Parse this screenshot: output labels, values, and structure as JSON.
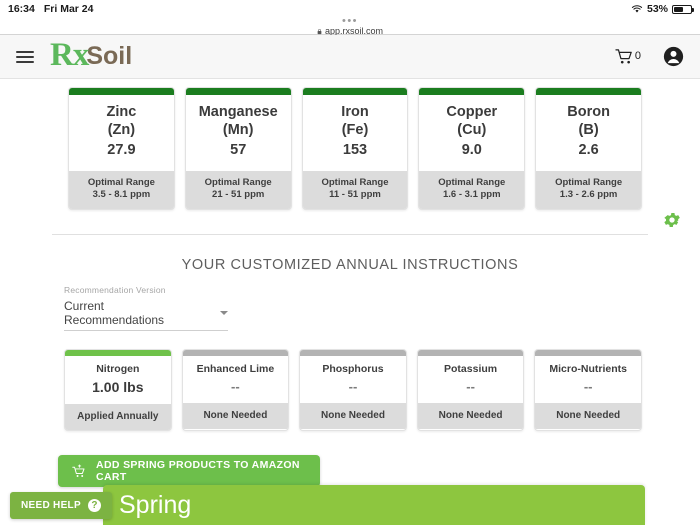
{
  "status_bar": {
    "time": "16:34",
    "date": "Fri Mar 24",
    "battery_percent": "53%",
    "wifi_icon": "wifi-icon",
    "battery_icon": "battery-icon"
  },
  "browser": {
    "dots": "•••",
    "url": "app.rxsoil.com",
    "lock_icon": "lock-icon"
  },
  "header": {
    "menu_icon": "hamburger-menu-icon",
    "logo_rx": "Rx",
    "logo_soil": "Soil",
    "cart_icon": "shopping-cart-icon",
    "cart_count": "0",
    "account_icon": "account-avatar-icon"
  },
  "settings": {
    "gear_icon": "gear-icon",
    "color": "#6cbf4b"
  },
  "nutrients": {
    "footer_label": "Optimal Range",
    "bar_color": "#1b7d1f",
    "cards": [
      {
        "name": "Zinc",
        "symbol": "(Zn)",
        "value": "27.9",
        "range": "3.5 - 8.1 ppm"
      },
      {
        "name": "Manganese",
        "symbol": "(Mn)",
        "value": "57",
        "range": "21 - 51 ppm"
      },
      {
        "name": "Iron",
        "symbol": "(Fe)",
        "value": "153",
        "range": "11 - 51 ppm"
      },
      {
        "name": "Copper",
        "symbol": "(Cu)",
        "value": "9.0",
        "range": "1.6 - 3.1 ppm"
      },
      {
        "name": "Boron",
        "symbol": "(B)",
        "value": "2.6",
        "range": "1.3 - 2.6 ppm"
      }
    ]
  },
  "instructions": {
    "title": "YOUR CUSTOMIZED ANNUAL INSTRUCTIONS",
    "select_label": "Recommendation Version",
    "select_value": "Current Recommendations",
    "select_options": [
      "Current Recommendations"
    ],
    "caret_icon": "chevron-down-icon"
  },
  "recommendations": {
    "active_bar_color": "#6fc24a",
    "inactive_bar_color": "#b3b3b3",
    "cards": [
      {
        "name": "Nitrogen",
        "value": "1.00 lbs",
        "status": "Applied Annually",
        "active": true
      },
      {
        "name": "Enhanced Lime",
        "value": "--",
        "status": "None Needed",
        "active": false
      },
      {
        "name": "Phosphorus",
        "value": "--",
        "status": "None Needed",
        "active": false
      },
      {
        "name": "Potassium",
        "value": "--",
        "status": "None Needed",
        "active": false
      },
      {
        "name": "Micro-Nutrients",
        "value": "--",
        "status": "None Needed",
        "active": false
      }
    ]
  },
  "amazon_button": {
    "label": "ADD SPRING PRODUCTS TO AMAZON CART",
    "icon": "add-to-cart-icon",
    "color": "#6dbf4b"
  },
  "season_banner": {
    "label": "Spring",
    "color": "#8dc63f"
  },
  "need_help": {
    "label": "NEED HELP",
    "icon": "question-mark-icon",
    "color": "#7cb342"
  }
}
